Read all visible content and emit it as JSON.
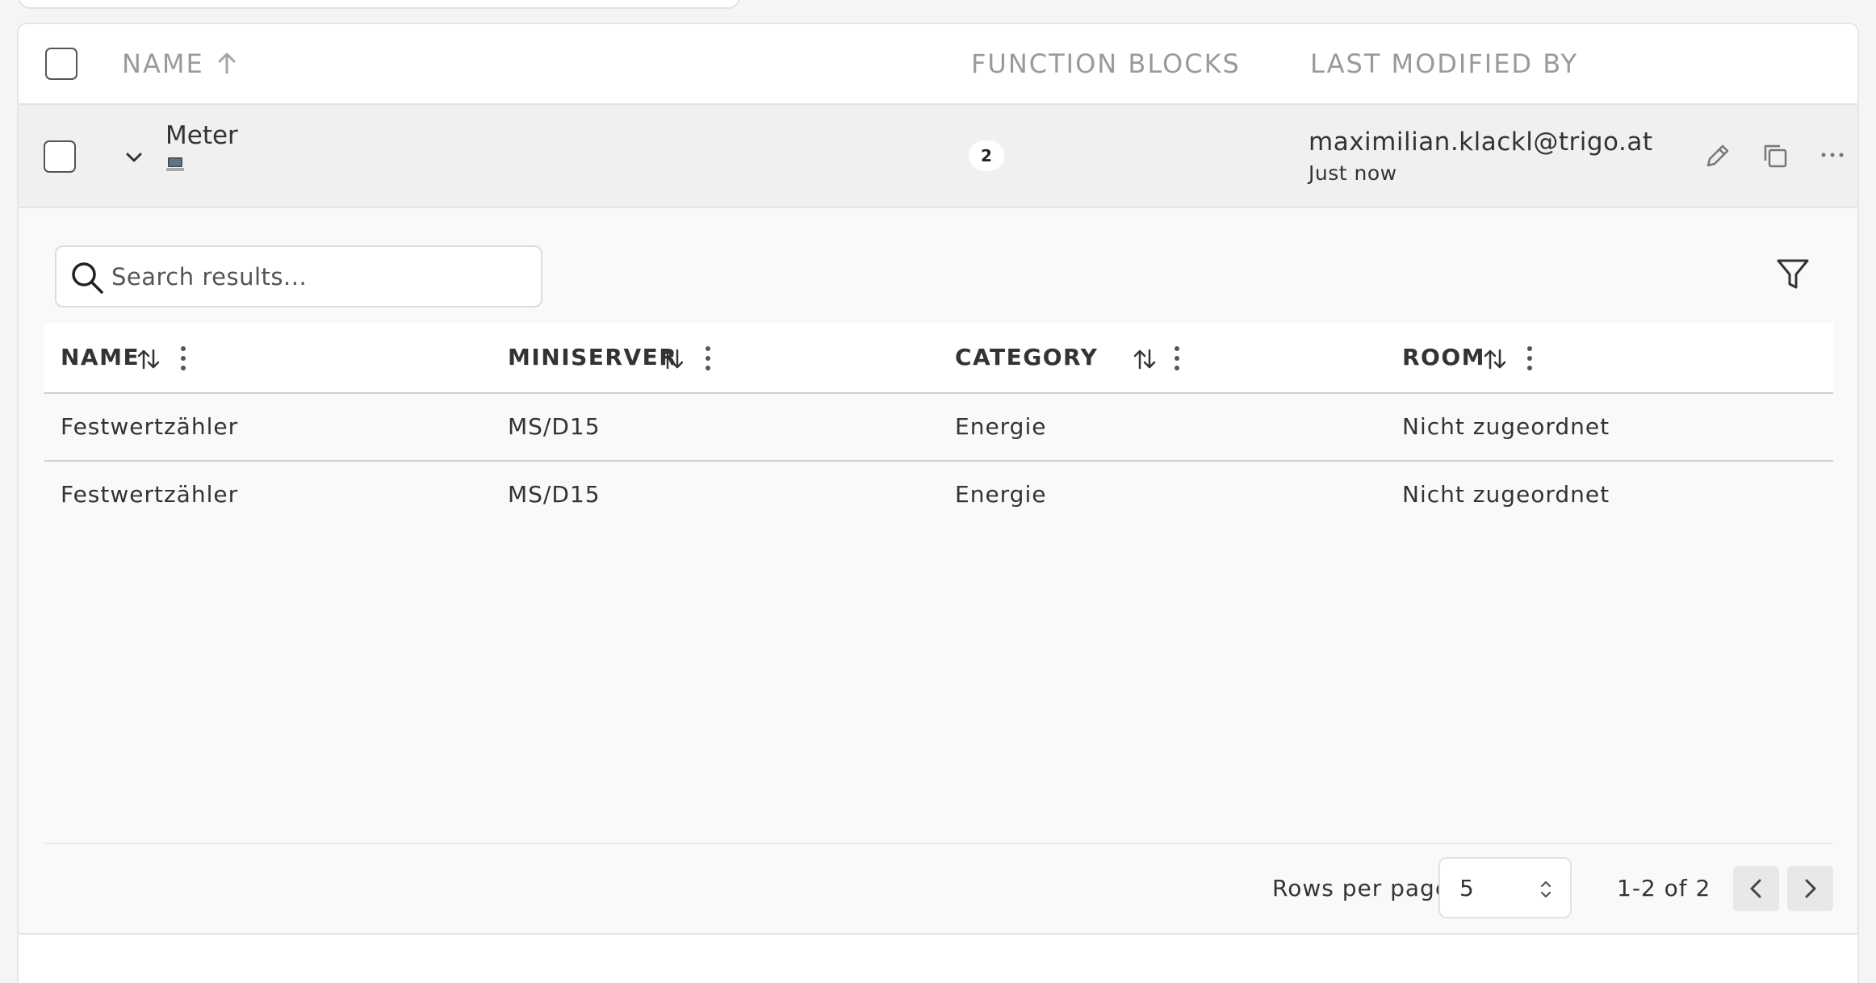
{
  "outer_table": {
    "headers": {
      "name": "NAME",
      "function_blocks": "FUNCTION BLOCKS",
      "last_modified_by": "LAST MODIFIED BY"
    },
    "row": {
      "name": "Meter",
      "function_blocks_count": "2",
      "modified_by": "maximilian.klackl@trigo.at",
      "modified_time": "Just now"
    }
  },
  "search": {
    "placeholder": "Search results...",
    "value": ""
  },
  "inner_table": {
    "columns": [
      "NAME",
      "MINISERVER",
      "CATEGORY",
      "ROOM"
    ],
    "rows": [
      [
        "Festwertzähler",
        "MS/D15",
        "Energie",
        "Nicht zugeordnet"
      ],
      [
        "Festwertzähler",
        "MS/D15",
        "Energie",
        "Nicht zugeordnet"
      ]
    ]
  },
  "pagination": {
    "rows_per_page_label": "Rows per page",
    "rows_per_page_value": "5",
    "range": "1-2 of 2"
  }
}
